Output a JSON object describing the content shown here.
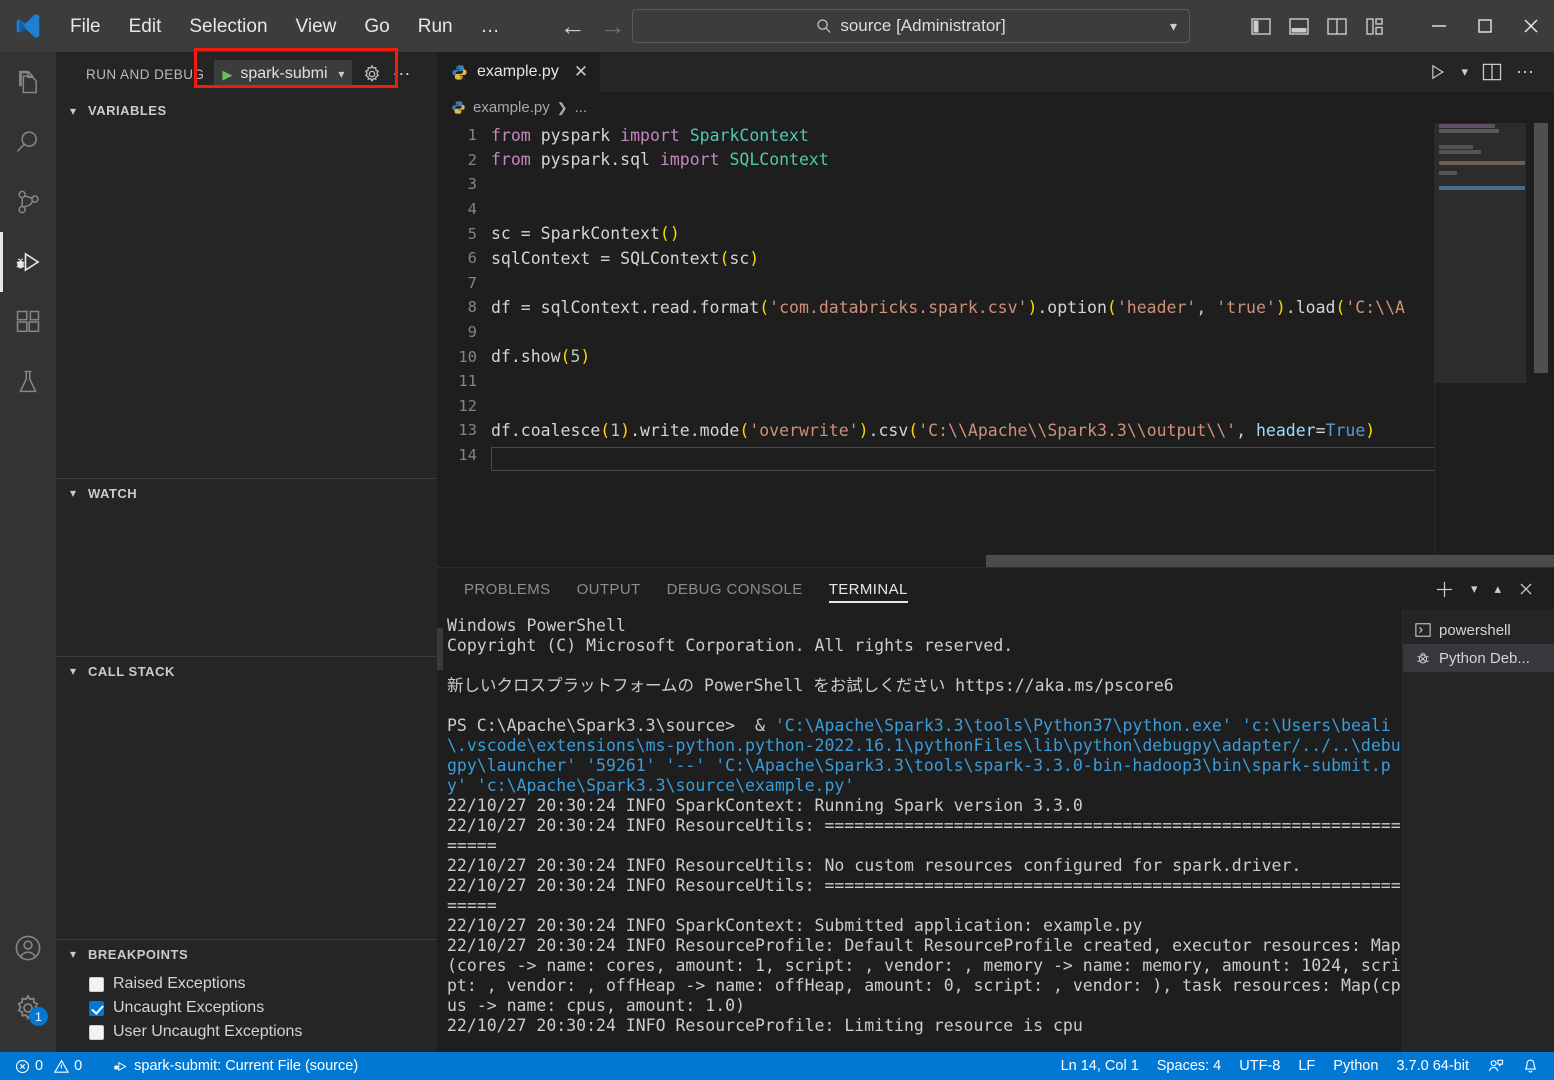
{
  "titlebar": {
    "menus": [
      "File",
      "Edit",
      "Selection",
      "View",
      "Go",
      "Run",
      "…"
    ],
    "search_value": "source [Administrator]",
    "back_icon": "arrow-left-icon",
    "forward_icon": "arrow-right-icon"
  },
  "sidebar": {
    "title": "RUN AND DEBUG",
    "debug_config": "spark-submi",
    "panes": [
      {
        "title": "VARIABLES"
      },
      {
        "title": "WATCH"
      },
      {
        "title": "CALL STACK"
      },
      {
        "title": "BREAKPOINTS"
      }
    ],
    "breakpoints": [
      {
        "label": "Raised Exceptions",
        "checked": false
      },
      {
        "label": "Uncaught Exceptions",
        "checked": true
      },
      {
        "label": "User Uncaught Exceptions",
        "checked": false
      }
    ]
  },
  "editor": {
    "tab_label": "example.py",
    "breadcrumb_file": "example.py",
    "breadcrumb_rest": "...",
    "lines": [
      {
        "n": 1,
        "text": "from pyspark import SparkContext"
      },
      {
        "n": 2,
        "text": "from pyspark.sql import SQLContext"
      },
      {
        "n": 3,
        "text": ""
      },
      {
        "n": 4,
        "text": ""
      },
      {
        "n": 5,
        "text": "sc = SparkContext()"
      },
      {
        "n": 6,
        "text": "sqlContext = SQLContext(sc)"
      },
      {
        "n": 7,
        "text": ""
      },
      {
        "n": 8,
        "text": "df = sqlContext.read.format('com.databricks.spark.csv').option('header', 'true').load('C:\\\\A"
      },
      {
        "n": 9,
        "text": ""
      },
      {
        "n": 10,
        "text": "df.show(5)"
      },
      {
        "n": 11,
        "text": ""
      },
      {
        "n": 12,
        "text": ""
      },
      {
        "n": 13,
        "text": "df.coalesce(1).write.mode('overwrite').csv('C:\\\\Apache\\\\Spark3.3\\\\output\\\\', header=True)"
      },
      {
        "n": 14,
        "text": ""
      }
    ]
  },
  "panel": {
    "tabs": [
      "PROBLEMS",
      "OUTPUT",
      "DEBUG CONSOLE",
      "TERMINAL"
    ],
    "active_tab": "TERMINAL",
    "terminal_header_1": "Windows PowerShell",
    "terminal_header_2": "Copyright (C) Microsoft Corporation. All rights reserved.",
    "terminal_jp": "新しいクロスプラットフォームの PowerShell をお試しください https://aka.ms/pscore6",
    "prompt_prefix": "PS C:\\Apache\\Spark3.3\\source>  & ",
    "prompt_cmd": "'C:\\Apache\\Spark3.3\\tools\\Python37\\python.exe' 'c:\\Users\\beali\\.vscode\\extensions\\ms-python.python-2022.16.1\\pythonFiles\\lib\\python\\debugpy\\adapter/../..\\debugpy\\launcher' '59261' '--' 'C:\\Apache\\Spark3.3\\tools\\spark-3.3.0-bin-hadoop3\\bin\\spark-submit.py' 'c:\\Apache\\Spark3.3\\source\\example.py'",
    "log_lines": [
      "22/10/27 20:30:24 INFO SparkContext: Running Spark version 3.3.0",
      "22/10/27 20:30:24 INFO ResourceUtils: ===============================================================",
      "22/10/27 20:30:24 INFO ResourceUtils: No custom resources configured for spark.driver.",
      "22/10/27 20:30:24 INFO ResourceUtils: ===============================================================",
      "22/10/27 20:30:24 INFO SparkContext: Submitted application: example.py",
      "22/10/27 20:30:24 INFO ResourceProfile: Default ResourceProfile created, executor resources: Map(cores -> name: cores, amount: 1, script: , vendor: , memory -> name: memory, amount: 1024, script: , vendor: , offHeap -> name: offHeap, amount: 0, script: , vendor: ), task resources: Map(cpus -> name: cpus, amount: 1.0)",
      "22/10/27 20:30:24 INFO ResourceProfile: Limiting resource is cpu"
    ],
    "terminal_list": [
      {
        "label": "powershell",
        "icon": "terminal-icon",
        "selected": false
      },
      {
        "label": "Python Deb...",
        "icon": "debug-bug-icon",
        "selected": true
      }
    ]
  },
  "statusbar": {
    "errors": "0",
    "warnings": "0",
    "debug_target": "spark-submit: Current File (source)",
    "cursor": "Ln 14, Col 1",
    "spaces": "Spaces: 4",
    "encoding": "UTF-8",
    "eol": "LF",
    "language": "Python",
    "interpreter": "3.7.0 64-bit",
    "accent_color": "#0078d4"
  }
}
